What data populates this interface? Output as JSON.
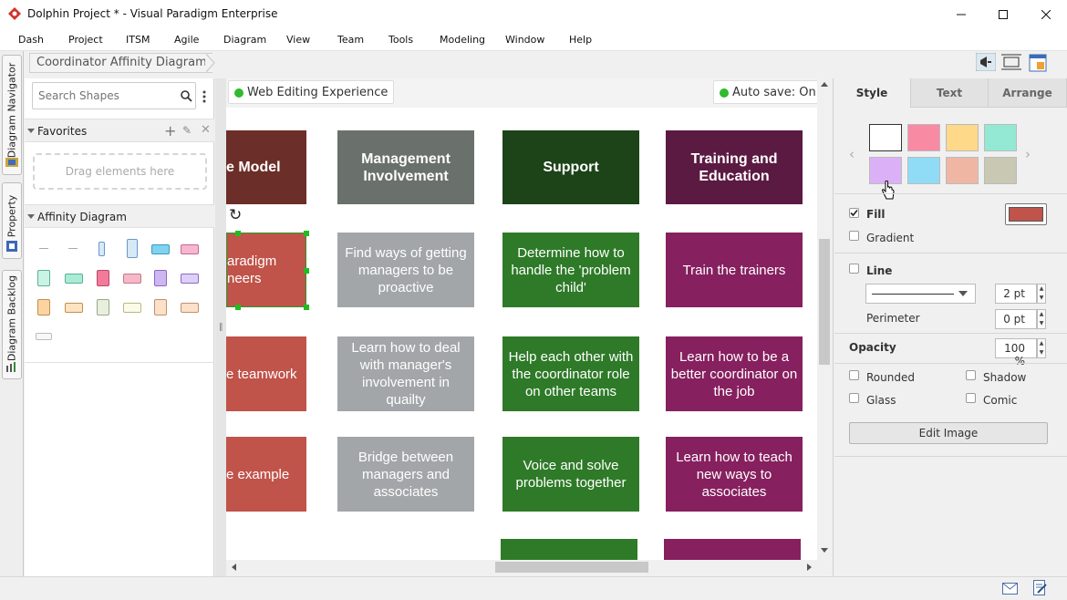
{
  "window": {
    "title": "Dolphin Project * - Visual Paradigm Enterprise"
  },
  "menu": [
    "Dash",
    "Project",
    "ITSM",
    "Agile",
    "Diagram",
    "View",
    "Team",
    "Tools",
    "Modeling",
    "Window",
    "Help"
  ],
  "left_tabs": [
    "Diagram Navigator",
    "Property",
    "Diagram Backlog"
  ],
  "breadcrumb": "Coordinator Affinity Diagram",
  "shapes_panel": {
    "search_placeholder": "Search Shapes",
    "favorites_label": "Favorites",
    "drop_hint": "Drag elements here",
    "affinity_label": "Affinity Diagram"
  },
  "canvas": {
    "web_editing": "Web Editing Experience",
    "auto_save": "Auto save: On",
    "columns": [
      {
        "header": "e Model",
        "color": "#6c2e28",
        "items": [
          {
            "text": "aradigm\nneers",
            "color": "#c0534a"
          },
          {
            "text": "e teamwork",
            "color": "#c0534a"
          },
          {
            "text": "e example",
            "color": "#c0534a"
          }
        ]
      },
      {
        "header": "Management Involvement",
        "color": "#6a706c",
        "items": [
          {
            "text": "Find ways of getting managers to be proactive",
            "color": "#a2a6a8"
          },
          {
            "text": "Learn how to deal with manager's involvement in quailty",
            "color": "#a2a6a8"
          },
          {
            "text": "Bridge between managers and associates",
            "color": "#a2a6a8"
          }
        ]
      },
      {
        "header": "Support",
        "color": "#1d4418",
        "items": [
          {
            "text": "Determine how to handle the 'problem child'",
            "color": "#2e7a28"
          },
          {
            "text": "Help each other with the coordinator role on other teams",
            "color": "#2e7a28"
          },
          {
            "text": "Voice and solve problems together",
            "color": "#2e7a28"
          }
        ]
      },
      {
        "header": "Training and Education",
        "color": "#5b1a42",
        "items": [
          {
            "text": "Train the trainers",
            "color": "#86205f"
          },
          {
            "text": "Learn how to be a better coordinator on the job",
            "color": "#86205f"
          },
          {
            "text": "Learn how to teach new ways to associates",
            "color": "#86205f"
          }
        ]
      }
    ]
  },
  "right_panel": {
    "tabs": [
      "Style",
      "Text",
      "Arrange"
    ],
    "swatches": [
      "#ffffff",
      "#f98aa4",
      "#fed98a",
      "#94e9d4",
      "#dcb0f7",
      "#90dcf7",
      "#efb7a3",
      "#c9c8b2"
    ],
    "fill_label": "Fill",
    "fill_color": "#c0534a",
    "gradient_label": "Gradient",
    "line_label": "Line",
    "line_weight": "2 pt",
    "perimeter_label": "Perimeter",
    "perimeter_value": "0 pt",
    "opacity_label": "Opacity",
    "opacity_value": "100 %",
    "rounded_label": "Rounded",
    "shadow_label": "Shadow",
    "glass_label": "Glass",
    "comic_label": "Comic",
    "edit_image_label": "Edit Image"
  }
}
